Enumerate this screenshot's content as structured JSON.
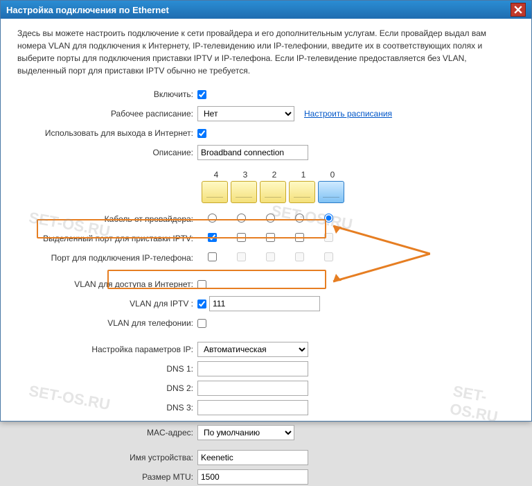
{
  "window": {
    "title": "Настройка подключения по Ethernet"
  },
  "intro": "Здесь вы можете настроить подключение к сети провайдера и его дополнительным услугам. Если провайдер выдал вам номера VLAN для подключения к Интернету, IP-телевидению или IP-телефонии, введите их в соответствующих полях и выберите порты для подключения приставки IPTV и IP-телефона. Если IP-телевидение предоставляется без VLAN, выделенный порт для приставки IPTV обычно не требуется.",
  "labels": {
    "enable": "Включить:",
    "schedule": "Рабочее расписание:",
    "schedule_link": "Настроить расписания",
    "use_internet": "Использовать для выхода в Интернет:",
    "description": "Описание:",
    "cable": "Кабель от провайдера:",
    "iptv_port": "Выделенный порт для приставки IPTV:",
    "phone_port": "Порт для подключения IP-телефона:",
    "vlan_internet": "VLAN для доступа в Интернет:",
    "vlan_iptv": "VLAN для IPTV :",
    "vlan_phone": "VLAN для телефонии:",
    "ip_params": "Настройка параметров IP:",
    "dns1": "DNS 1:",
    "dns2": "DNS 2:",
    "dns3": "DNS 3:",
    "mac": "MAC-адрес:",
    "devname": "Имя устройства:",
    "mtu": "Размер MTU:"
  },
  "values": {
    "schedule": "Нет",
    "description": "Broadband connection",
    "vlan_iptv": "111",
    "ip_params": "Автоматическая",
    "mac": "По умолчанию",
    "devname": "Keenetic",
    "mtu": "1500",
    "dns1": "",
    "dns2": "",
    "dns3": ""
  },
  "ports": [
    "4",
    "3",
    "2",
    "1",
    "0"
  ],
  "watermark": "SET-OS.RU"
}
